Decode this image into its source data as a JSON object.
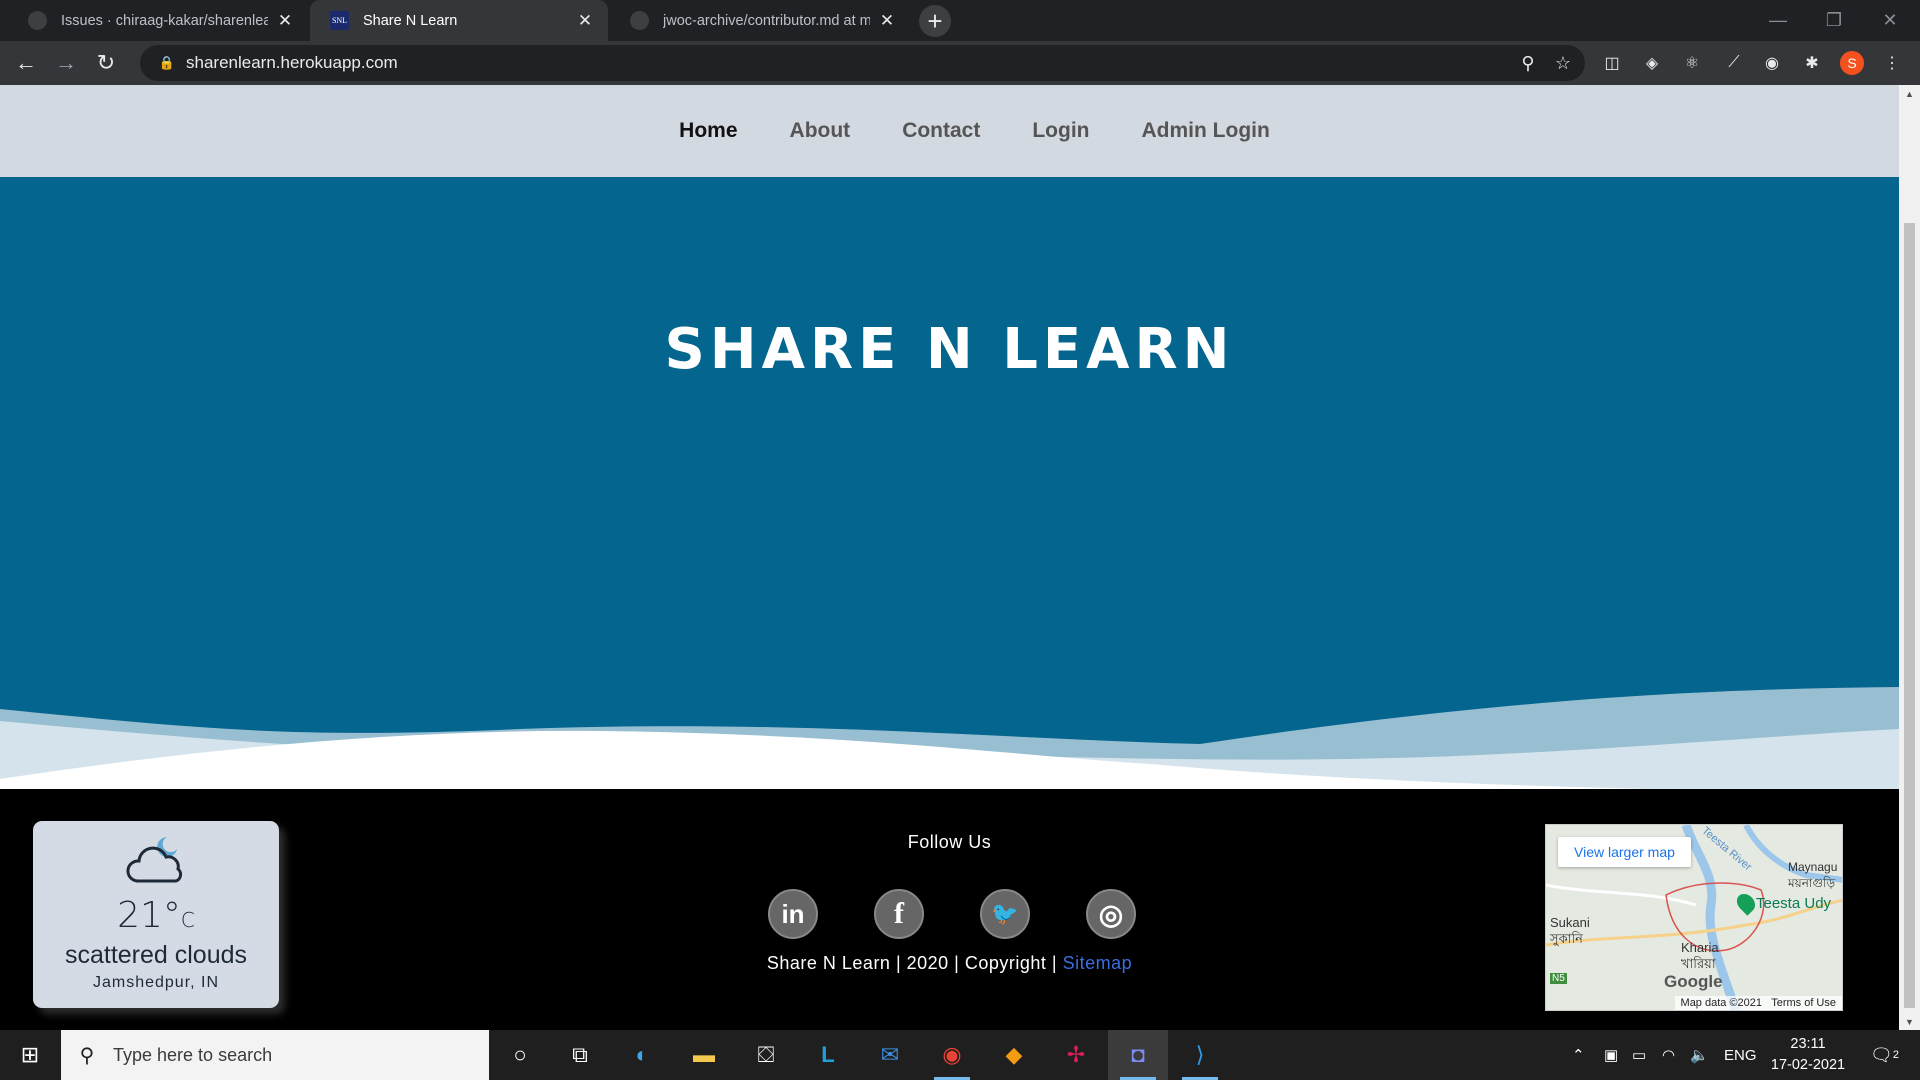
{
  "browser": {
    "tabs": [
      {
        "title": "Issues · chiraag-kakar/sharenlearn",
        "active": false
      },
      {
        "title": "Share N Learn",
        "active": true,
        "favicon_text": "SNL"
      },
      {
        "title": "jwoc-archive/contributor.md at m",
        "active": false
      }
    ],
    "url": "sharenlearn.herokuapp.com",
    "profile_initial": "S"
  },
  "site": {
    "nav": [
      {
        "label": "Home",
        "active": true
      },
      {
        "label": "About",
        "active": false
      },
      {
        "label": "Contact",
        "active": false
      },
      {
        "label": "Login",
        "active": false
      },
      {
        "label": "Admin Login",
        "active": false
      }
    ],
    "hero_title": "SHARE N LEARN",
    "colors": {
      "hero": "#04668f",
      "nav_bg": "#d3d9e0",
      "footer": "#000000",
      "link": "#3b6ee0"
    }
  },
  "footer": {
    "weather": {
      "temp": "21°",
      "unit": "C",
      "description": "scattered clouds",
      "location": "Jamshedpur, IN"
    },
    "follow_label": "Follow Us",
    "socials": [
      {
        "name": "linkedin-icon",
        "glyph": "in"
      },
      {
        "name": "facebook-icon",
        "glyph": "f"
      },
      {
        "name": "twitter-icon",
        "glyph": "🐦"
      },
      {
        "name": "instagram-icon",
        "glyph": "◎"
      }
    ],
    "copyright_text": "Share N Learn | 2020 | Copyright |",
    "sitemap_label": "Sitemap",
    "map": {
      "button": "View larger map",
      "labels": [
        "Teesta River",
        "Maynagu",
        "ময়নাগুড়ি",
        "Teesta Udy",
        "Sukani",
        "সুকানি",
        "Kharia",
        "খারিয়া",
        "N5"
      ],
      "logo": "Google",
      "data": "Map data ©2021",
      "terms": "Terms of Use"
    }
  },
  "taskbar": {
    "search_placeholder": "Type here to search",
    "language": "ENG",
    "time": "23:11",
    "date": "17-02-2021",
    "notifications": "2"
  }
}
